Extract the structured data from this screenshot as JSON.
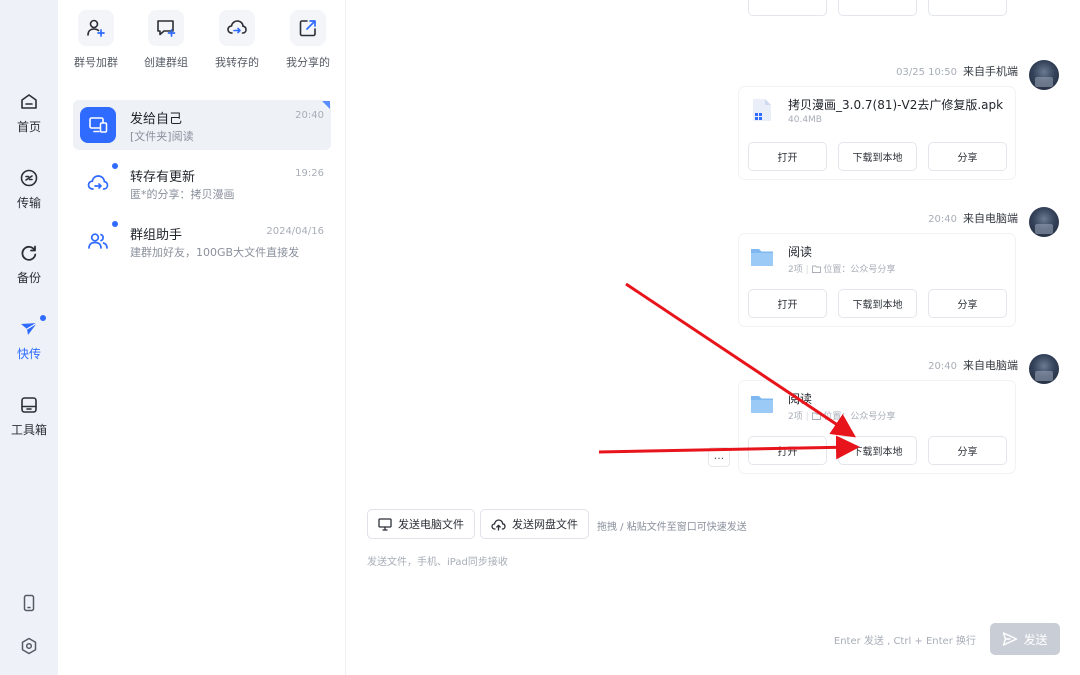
{
  "colors": {
    "accent": "#2f6bff",
    "annotation_arrow": "#e8141b",
    "rail_bg": "#eef2f8"
  },
  "rail": {
    "items": [
      {
        "label": "首页",
        "icon": "home-icon"
      },
      {
        "label": "传输",
        "icon": "transfer-icon"
      },
      {
        "label": "备份",
        "icon": "backup-icon"
      },
      {
        "label": "快传",
        "icon": "quick-transfer-icon",
        "active": true,
        "badge": true
      },
      {
        "label": "工具箱",
        "icon": "toolbox-icon"
      }
    ],
    "bottom_icons": [
      "phone-icon",
      "settings-icon"
    ]
  },
  "quick_actions": [
    {
      "label": "群号加群",
      "icon": "add-user-icon"
    },
    {
      "label": "创建群组",
      "icon": "create-group-icon"
    },
    {
      "label": "我转存的",
      "icon": "cloud-transfer-icon"
    },
    {
      "label": "我分享的",
      "icon": "share-out-icon"
    }
  ],
  "conversations": [
    {
      "name": "发给自己",
      "time": "20:40",
      "preview": "[文件夹]阅读",
      "selected": true
    },
    {
      "name": "转存有更新",
      "time": "19:26",
      "preview": "匿*的分享：拷贝漫画",
      "badge": true
    },
    {
      "name": "群组助手",
      "time": "2024/04/16",
      "preview": "建群加好友，100GB大文件直接发",
      "badge": true
    }
  ],
  "messages": [
    {
      "time": "03/25 10:50",
      "source": "来自手机端",
      "file_name": "拷贝漫画_3.0.7(81)-V2去广修复版.apk",
      "meta": "40.4MB",
      "file_type": "apk",
      "actions": [
        "打开",
        "下载到本地",
        "分享"
      ]
    },
    {
      "time": "20:40",
      "source": "来自电脑端",
      "file_name": "阅读",
      "meta_count": "2项",
      "meta_location": "位置：公众号分享",
      "file_type": "folder",
      "actions": [
        "打开",
        "下载到本地",
        "分享"
      ]
    },
    {
      "time": "20:40",
      "source": "来自电脑端",
      "file_name": "阅读",
      "meta_count": "2项",
      "meta_location": "位置：公众号分享",
      "file_type": "folder",
      "actions": [
        "打开",
        "下载到本地",
        "分享"
      ]
    }
  ],
  "more_label": "...",
  "composer": {
    "send_pc_file": "发送电脑文件",
    "send_cloud_file": "发送网盘文件",
    "drag_hint": "拖拽 / 粘贴文件至窗口可快速发送",
    "placeholder": "发送文件，手机、iPad同步接收",
    "shortcut_hint": "Enter 发送 , Ctrl + Enter 换行",
    "send_label": "发送"
  }
}
